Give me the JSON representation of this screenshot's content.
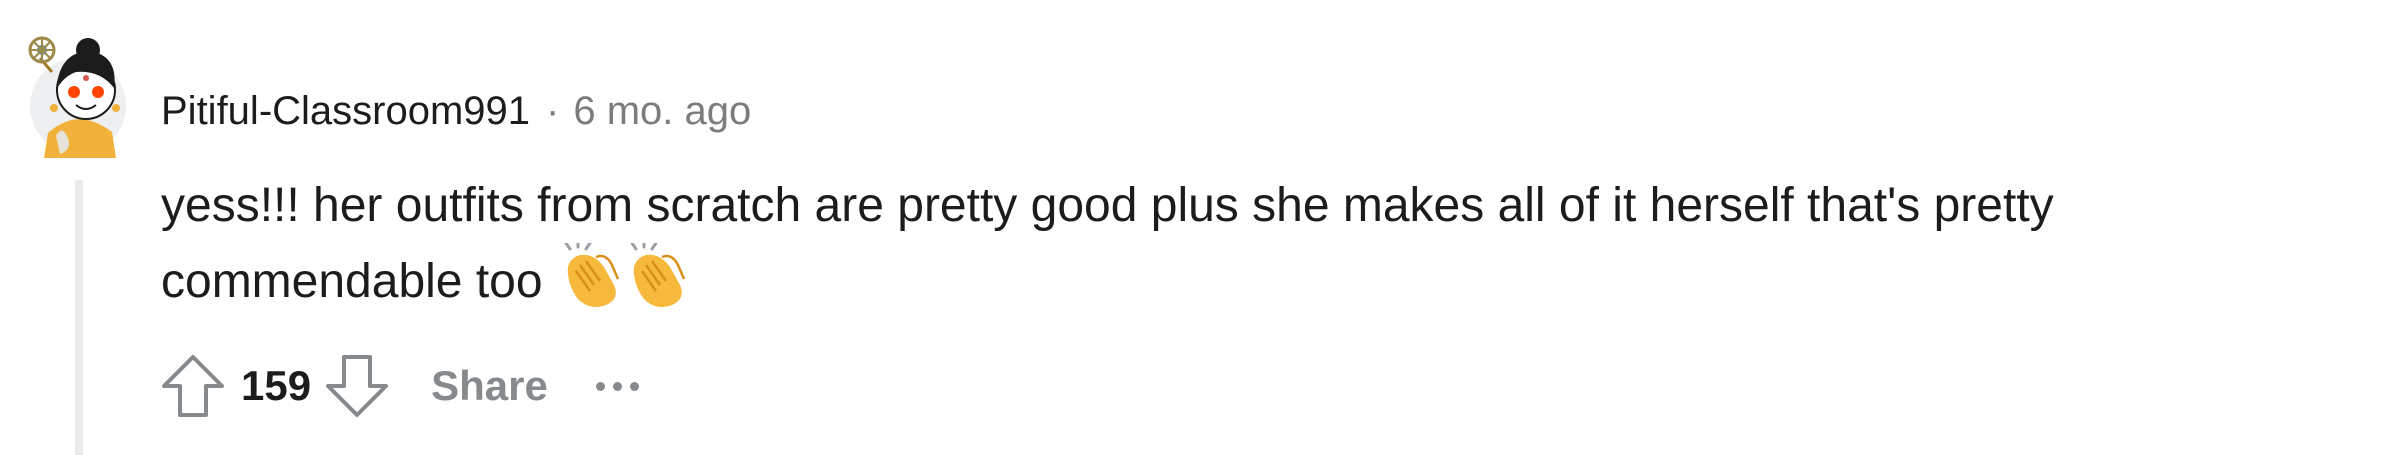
{
  "comment": {
    "username": "Pitiful-Classroom991",
    "separator": "·",
    "timestamp": "6 mo. ago",
    "body": "yess!!! her outfits from scratch are pretty good plus she makes all of it herself that's pretty commendable too",
    "emoji": [
      "clapping-hands-icon",
      "clapping-hands-icon"
    ],
    "score": "159",
    "share_label": "Share",
    "avatar": "snoo-avatar-icon"
  },
  "colors": {
    "text": "#1c1c1c",
    "muted": "#7c7c7c",
    "action": "#878a8c",
    "thread_line": "#e8eaec",
    "emoji_yellow": "#f6b93b"
  }
}
